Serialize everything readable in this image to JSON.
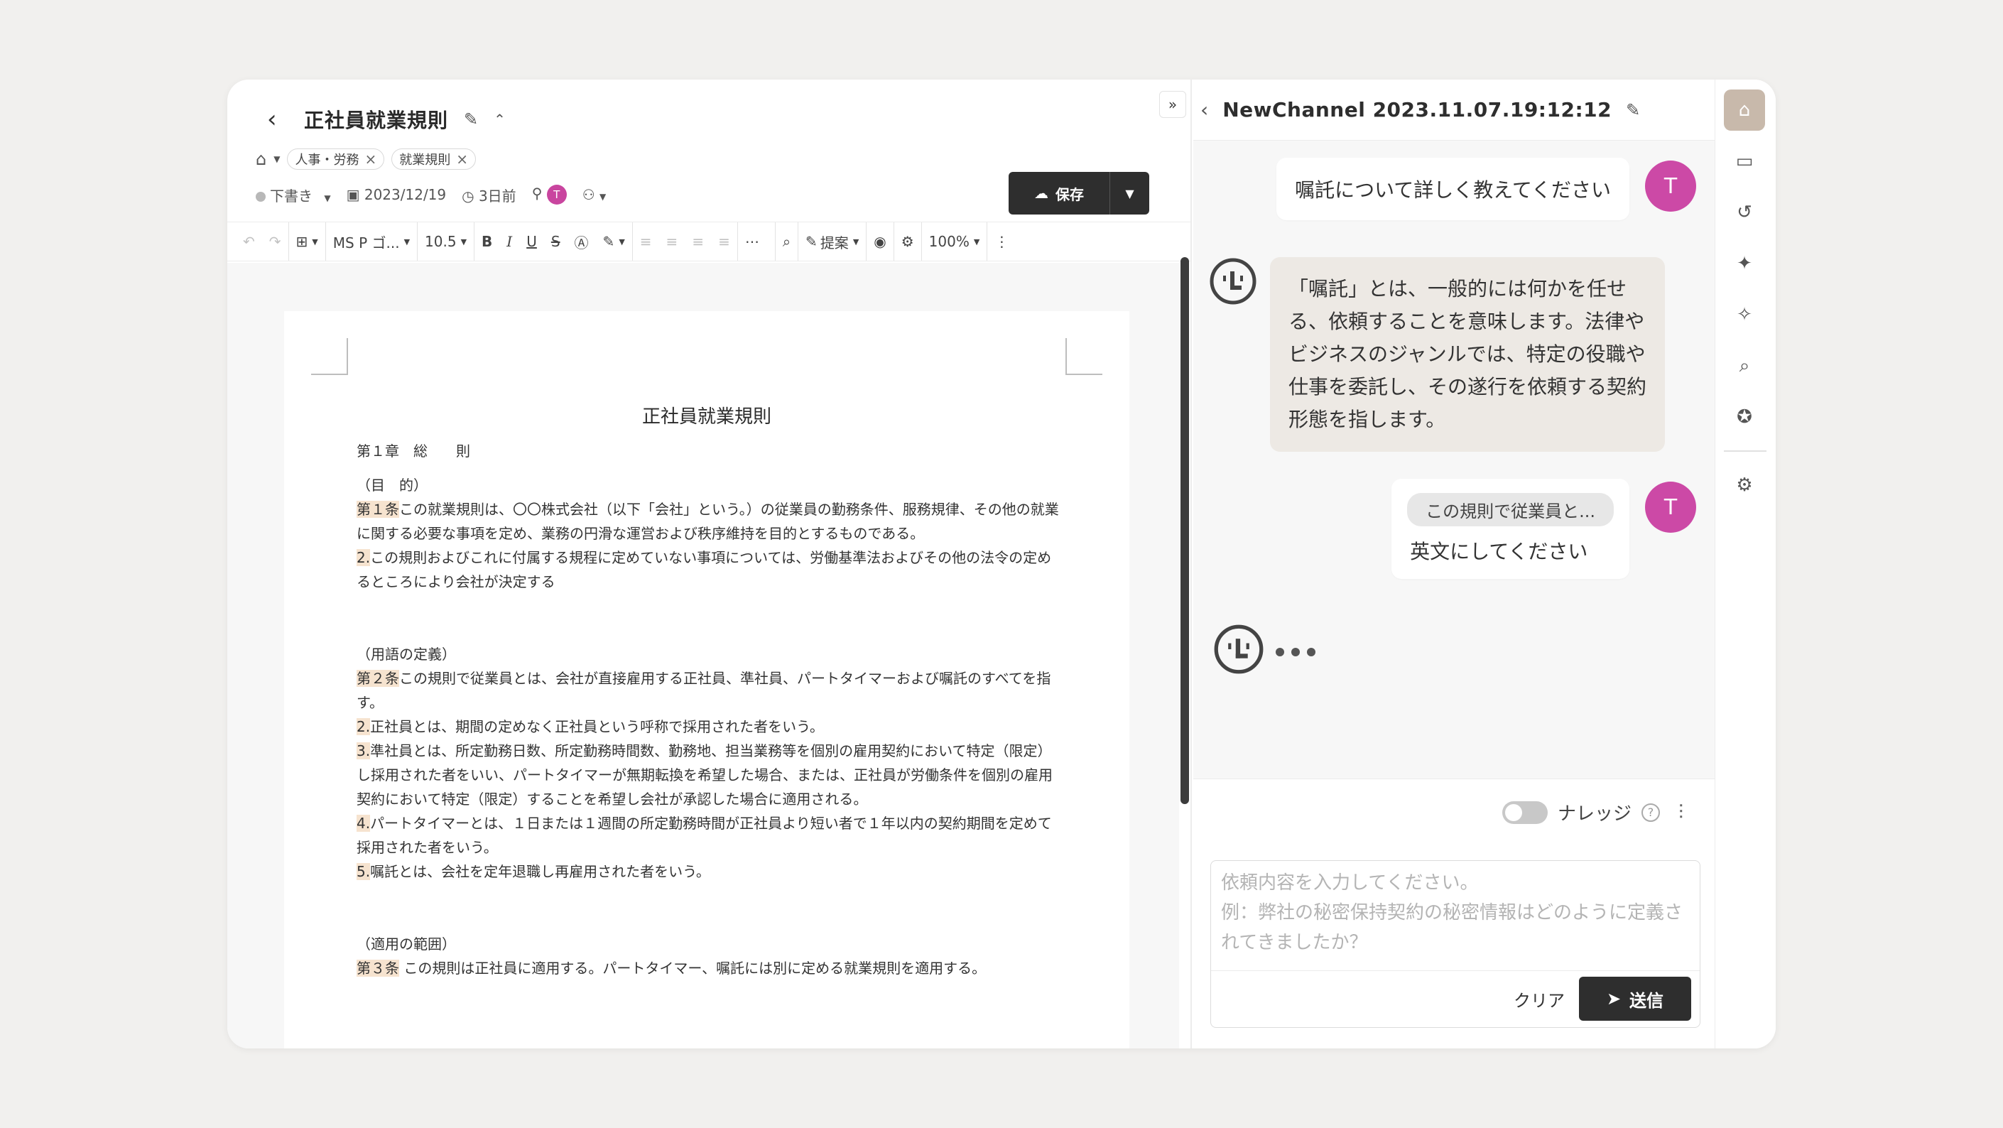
{
  "document": {
    "title": "正社員就業規則",
    "tags": [
      {
        "label": "人事・労務"
      },
      {
        "label": "就業規則"
      }
    ],
    "status": "下書き",
    "date": "2023/12/19",
    "relative_time": "3日前",
    "owner_initial": "T",
    "save_label": "保存"
  },
  "toolbar": {
    "font": "MS P ゴ...",
    "size": "10.5",
    "suggest": "提案",
    "zoom": "100%",
    "bold": "B",
    "italic": "I",
    "underline": "U",
    "strike": "S"
  },
  "page": {
    "title": "正社員就業規則",
    "chapter": "第１章　総　　則",
    "sec1_heading": "（目　的）",
    "art1_label": "第１条",
    "art1_text": "この就業規則は、〇〇株式会社（以下「会社」という。）の従業員の勤務条件、服務規律、その他の就業に関する必要な事項を定め、業務の円滑な運営および秩序維持を目的とするものである。",
    "art1_p2_label": "2.",
    "art1_p2_text": "この規則およびこれに付属する規程に定めていない事項については、労働基準法およびその他の法令の定めるところにより会社が決定する",
    "sec2_heading": "（用語の定義）",
    "art2_label": "第２条",
    "art2_text": "この規則で従業員とは、会社が直接雇用する正社員、準社員、パートタイマーおよび嘱託のすべてを指す。",
    "art2_p2_label": "2.",
    "art2_p2_text": "正社員とは、期間の定めなく正社員という呼称で採用された者をいう。",
    "art2_p3_label": "3.",
    "art2_p3_text": "準社員とは、所定勤務日数、所定勤務時間数、勤務地、担当業務等を個別の雇用契約において特定（限定）し採用された者をいい、パートタイマーが無期転換を希望した場合、または、正社員が労働条件を個別の雇用契約において特定（限定）することを希望し会社が承認した場合に適用される。",
    "art2_p4_label": "4.",
    "art2_p4_text": "パートタイマーとは、１日または１週間の所定勤務時間が正社員より短い者で１年以内の契約期間を定めて採用された者をいう。",
    "art2_p5_label": "5.",
    "art2_p5_text": "嘱託とは、会社を定年退職し再雇用された者をいう。",
    "sec3_heading": "（適用の範囲）",
    "art3_label": "第３条",
    "art3_text": " この規則は正社員に適用する。パートタイマー、嘱託には別に定める就業規則を適用する。"
  },
  "chat": {
    "channel_title": "NewChannel 2023.11.07.19:12:12",
    "user_initial": "T",
    "messages": [
      {
        "role": "user",
        "text": "嘱託について詳しく教えてください"
      },
      {
        "role": "assistant",
        "text": "「嘱託」とは、一般的には何かを任せる、依頼することを意味します。法律やビジネスのジャンルでは、特定の役職や仕事を委託し、その遂行を依頼する契約形態を指します。"
      },
      {
        "role": "user",
        "quote": "この規則で従業員と...",
        "text": "英文にしてください"
      }
    ],
    "knowledge_label": "ナレッジ",
    "input_placeholder": "依頼内容を入力してください。\n例：弊社の秘密保持契約の秘密情報はどのように定義されてきましたか？",
    "clear_label": "クリア",
    "send_label": "送信"
  },
  "icons": {
    "rail": [
      "home-icon",
      "chat-icon",
      "history-icon",
      "sparkle-icon",
      "magic-icon",
      "search-icon",
      "award-icon",
      "settings-icon"
    ]
  },
  "colors": {
    "accent_dark": "#2e2e2e",
    "avatar": "#cc49a6",
    "highlight": "#f6e3cf",
    "bot_bubble": "#ede9e4",
    "rail_active": "#c8b9ab"
  }
}
